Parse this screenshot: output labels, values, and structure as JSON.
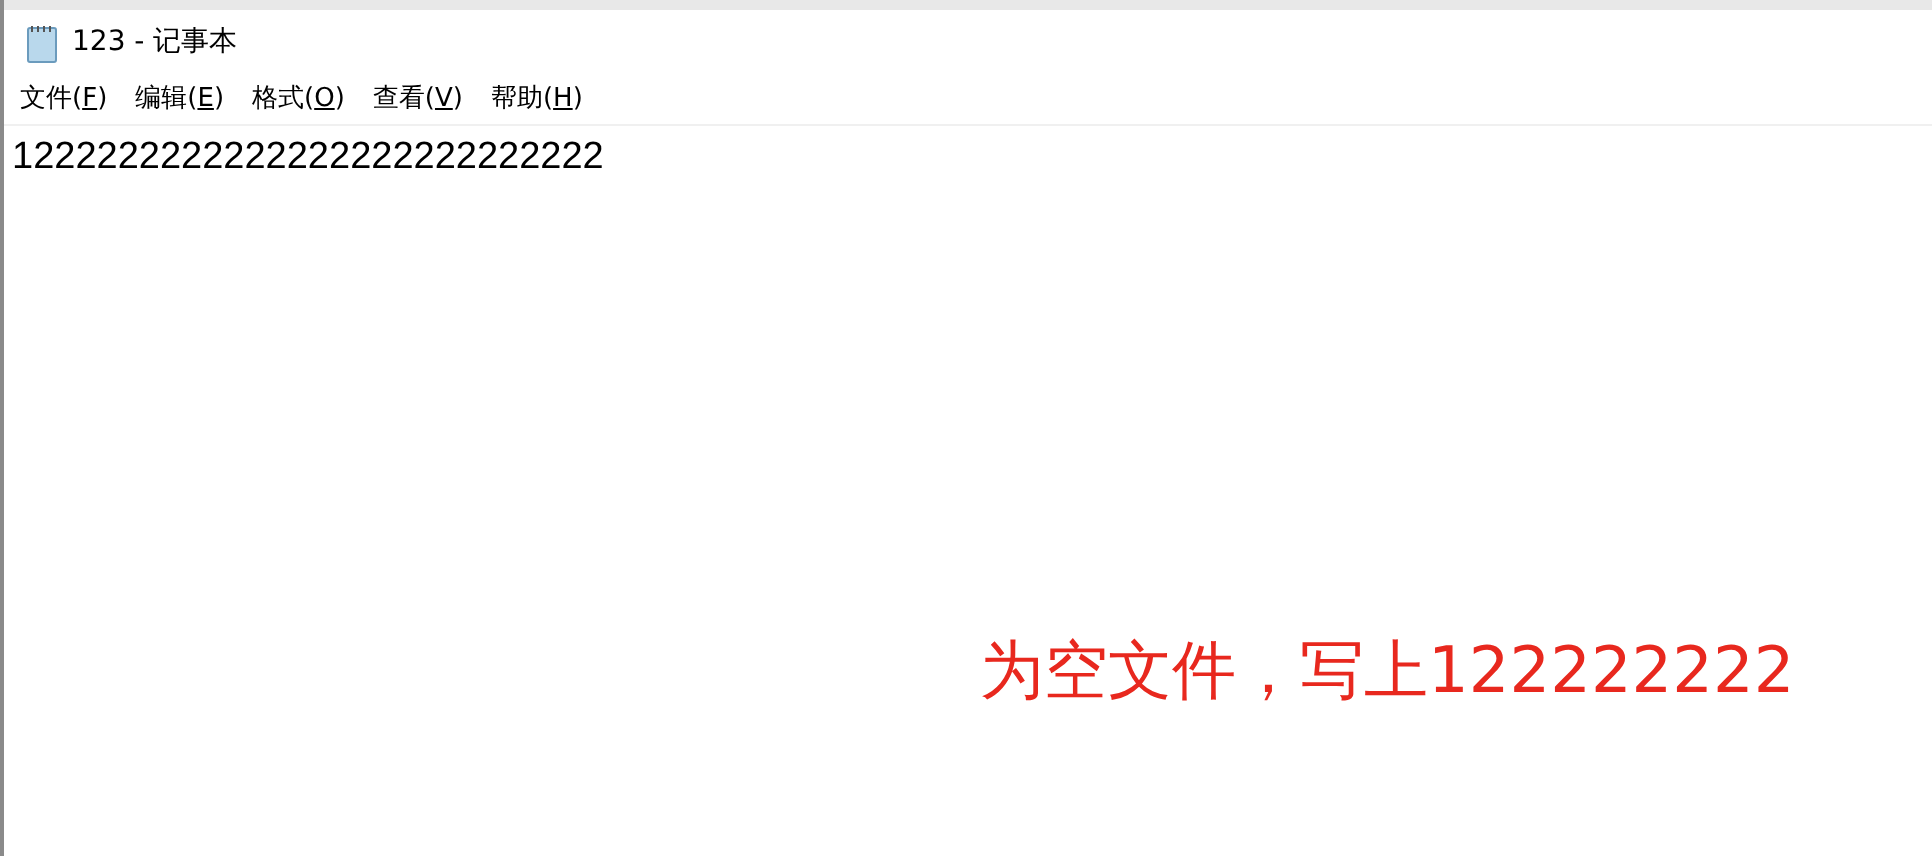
{
  "window": {
    "title": "123 - 记事本"
  },
  "menu": [
    {
      "before": "文件(",
      "key": "F",
      "after": ")"
    },
    {
      "before": "编辑(",
      "key": "E",
      "after": ")"
    },
    {
      "before": "格式(",
      "key": "O",
      "after": ")"
    },
    {
      "before": "查看(",
      "key": "V",
      "after": ")"
    },
    {
      "before": "帮助(",
      "key": "H",
      "after": ")"
    }
  ],
  "editor": {
    "value": "1222222222222222222222222222"
  },
  "annotation": "为空文件，写上122222222"
}
